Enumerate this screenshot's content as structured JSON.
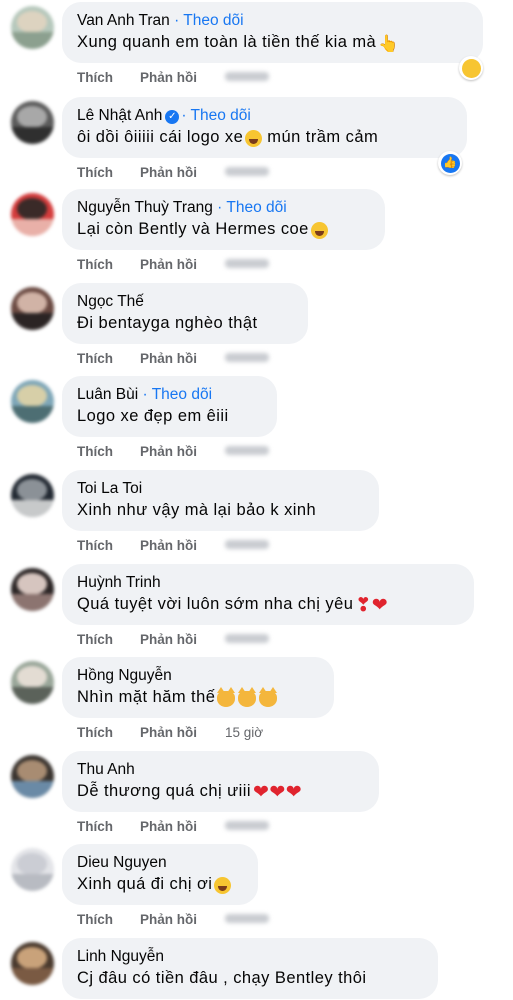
{
  "comments": [
    {
      "name": "Van Anh Tran",
      "follow": "Theo dõi",
      "verified": false,
      "text": "Xung quanh em toàn là tiền thế kia mà",
      "emoji": "👆",
      "reaction": "haha",
      "like": "Thích",
      "reply": "Phản hồi",
      "time": ""
    },
    {
      "name": "Lê Nhật Anh",
      "follow": "Theo dõi",
      "verified": true,
      "text": "ôi dồi ôiiiii cái logo xe",
      "emoji": "😛",
      "text2": "mún trầm cảm",
      "reaction": "like",
      "like": "Thích",
      "reply": "Phản hồi",
      "time": ""
    },
    {
      "name": "Nguyễn Thuỳ Trang",
      "follow": "Theo dõi",
      "verified": false,
      "text": "Lại còn Bently và Hermes coe",
      "emoji": "😊",
      "like": "Thích",
      "reply": "Phản hồi",
      "time": ""
    },
    {
      "name": "Ngọc Thế",
      "text": "Đi bentayga nghèo thật",
      "like": "Thích",
      "reply": "Phản hồi",
      "time": ""
    },
    {
      "name": "Luân Bùi",
      "follow": "Theo dõi",
      "verified": false,
      "text": "Logo xe đẹp em êiii",
      "like": "Thích",
      "reply": "Phản hồi",
      "time": ""
    },
    {
      "name": "Toi La Toi",
      "text": "Xinh như vậy mà lại bảo k xinh",
      "like": "Thích",
      "reply": "Phản hồi",
      "time": ""
    },
    {
      "name": "Huỳnh Trinh",
      "text": "Quá tuyệt vời luôn sớm nha chị yêu",
      "emoji": "❣❤",
      "like": "Thích",
      "reply": "Phản hồi",
      "time": ""
    },
    {
      "name": "Hồng Nguyễn",
      "text": "Nhìn mặt hăm thế",
      "emoji": "😼😼😼",
      "like": "Thích",
      "reply": "Phản hồi",
      "time": "15 giờ"
    },
    {
      "name": "Thu Anh",
      "text": "Dễ thương quá chị ưiii",
      "emoji": "❤❤❤",
      "like": "Thích",
      "reply": "Phản hồi",
      "time": ""
    },
    {
      "name": "Dieu Nguyen",
      "text": "Xinh quá đi chị ơi",
      "emoji": "😆",
      "like": "Thích",
      "reply": "Phản hồi",
      "time": ""
    },
    {
      "name": "Linh Nguyễn",
      "text": "Cj đâu có tiền đâu , chạy Bentley thôi",
      "like": "",
      "reply": "",
      "time": ""
    }
  ]
}
